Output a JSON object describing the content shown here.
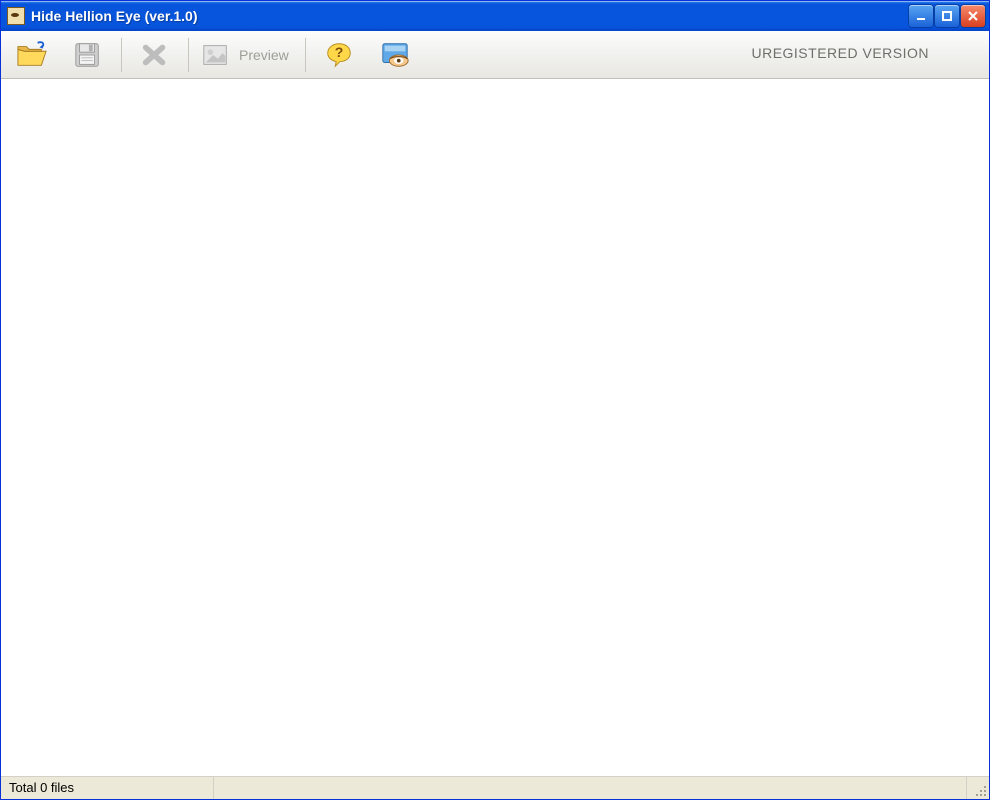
{
  "window": {
    "title": "Hide Hellion Eye (ver.1.0)"
  },
  "toolbar": {
    "open_label": "",
    "save_label": "",
    "delete_label": "",
    "preview_label": "Preview",
    "help_label": "",
    "about_label": "",
    "registration_notice": "UREGISTERED VERSION"
  },
  "statusbar": {
    "total_files": "Total 0 files"
  }
}
